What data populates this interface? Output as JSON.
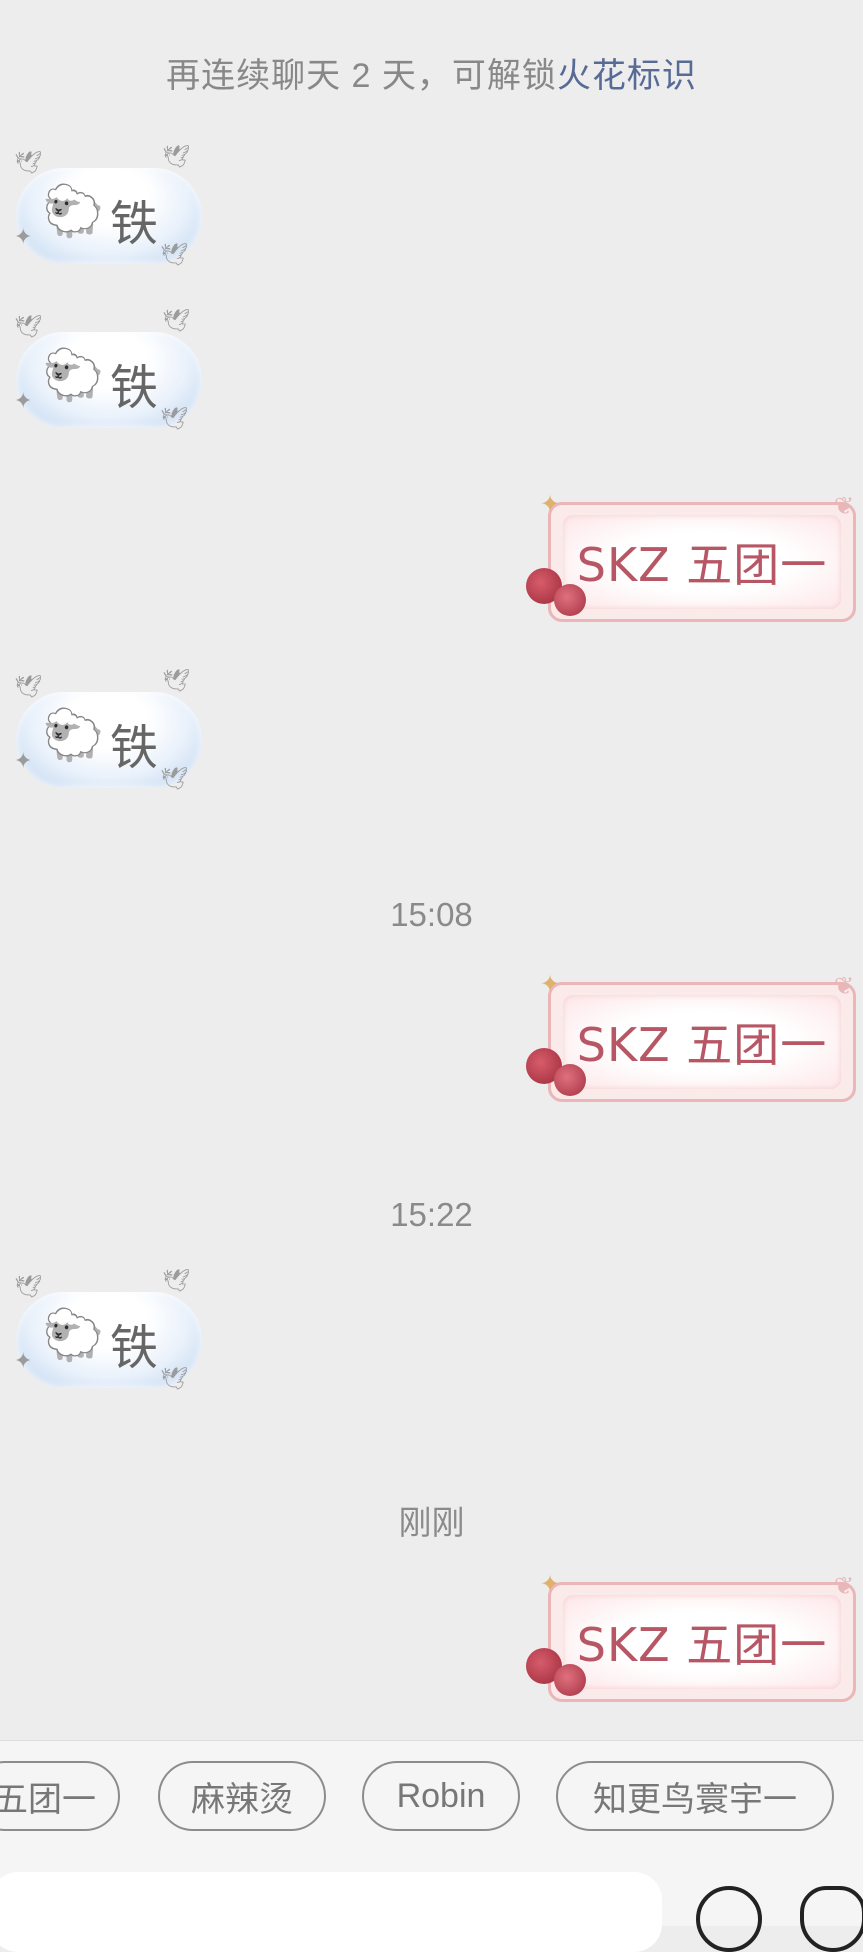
{
  "notice": {
    "prefix": "再连续聊天 2 天，可解锁",
    "link": "火花标识"
  },
  "messages": {
    "left_text": "铁",
    "left_emoji": "🐑",
    "right_text": "SKZ 五团一"
  },
  "times": [
    "15:08",
    "15:22",
    "刚刚"
  ],
  "quick_replies": [
    "五团一",
    "麻辣烫",
    "Robin",
    "知更鸟寰宇一"
  ],
  "colors": {
    "link": "#576b95",
    "right_text": "#b75664"
  }
}
